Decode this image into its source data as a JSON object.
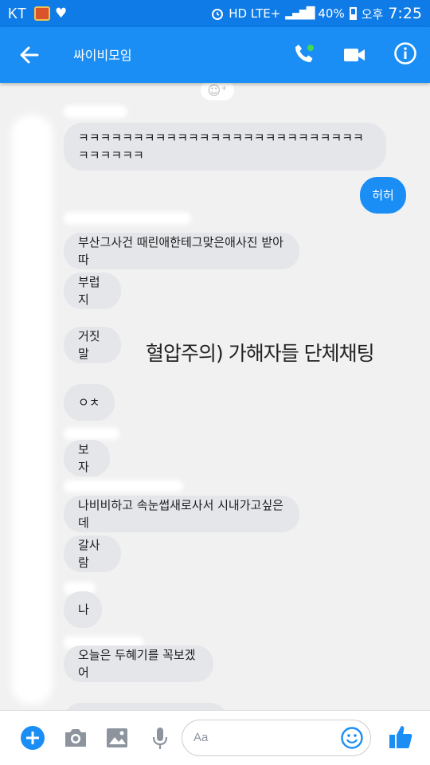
{
  "status_bar": {
    "carrier": "KT",
    "heart": "♥",
    "network": "HD LTE+",
    "battery": "40%",
    "ampm": "오후",
    "time": "7:25"
  },
  "header": {
    "title": "싸이비모임"
  },
  "messages": [
    {
      "text": "ㅋㅋㅋㅋㅋㅋㅋㅋㅋㅋㅋㅋㅋㅋㅋㅋㅋㅋㅋㅋㅋㅋㅋㅋㅋㅋㅋㅋㅋㅋㅋㅋ"
    },
    {
      "text": "허허"
    },
    {
      "text": "부산그사건 때린애한테그맞은애사진 받아따"
    },
    {
      "text": "부럽지"
    },
    {
      "text": "거짓말"
    },
    {
      "text": "ㅇㅊ"
    },
    {
      "text": "보자"
    },
    {
      "text": "나비비하고 속눈썹새로사서 시내가고싶은데"
    },
    {
      "text": "갈사람"
    },
    {
      "text": "나"
    },
    {
      "text": "오늘은 두혜기를 꼭보겠어"
    }
  ],
  "caption": "혈압주의) 가해자들 단체채팅",
  "composer": {
    "placeholder": "Aa"
  },
  "colors": {
    "header": "#1a8ef5",
    "status_bar": "#0f7be6",
    "bubble_incoming": "#e4e6ea",
    "bubble_outgoing": "#1a8ef5",
    "call_dot": "#43d854"
  },
  "icons": [
    "back-arrow-icon",
    "phone-icon",
    "video-camera-icon",
    "info-icon",
    "add-icon",
    "camera-icon",
    "image-icon",
    "microphone-icon",
    "emoji-icon",
    "thumbs-up-icon"
  ]
}
